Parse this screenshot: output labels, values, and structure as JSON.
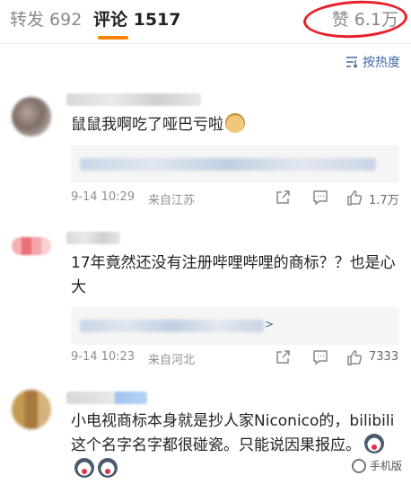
{
  "tabs": {
    "repost": "转发 692",
    "comment": "评论 1517",
    "like": "赞 6.1万"
  },
  "sort": {
    "label": "按热度"
  },
  "comments": [
    {
      "text": "鼠鼠我啊吃了哑巴亏啦",
      "emoji": "doge",
      "time": "9-14 10:29",
      "source": "来自江苏",
      "likes": "1.7万",
      "has_reply_arrow": false
    },
    {
      "text": "17年竟然还没有注册哔哩哔哩的商标？？也是心大",
      "time": "9-14 10:23",
      "source": "来自河北",
      "likes": "7333",
      "reply_arrow": ">"
    },
    {
      "text": "小电视商标本身就是抄人家Niconico的，bilibili这个名字名字都很碰瓷。只能说因果报应。",
      "emoji": "husky"
    }
  ],
  "watermark": "手机版"
}
